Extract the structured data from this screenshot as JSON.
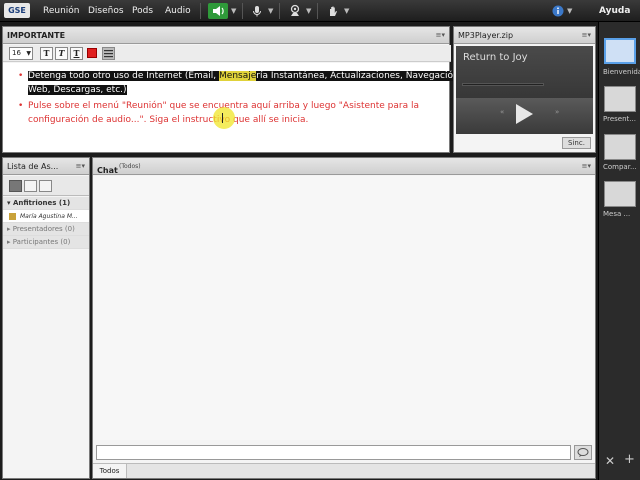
{
  "menubar": {
    "logo": "GSE",
    "items": [
      "Reunión",
      "Diseños",
      "Pods",
      "Audio"
    ],
    "help": "Ayuda",
    "colors": {
      "bar": "#2a2a2a",
      "speaker_active": "#2f9a3a"
    }
  },
  "note_pod": {
    "title": "IMPORTANTE",
    "font_size": "16",
    "color_swatch": "#e02020",
    "lines": [
      {
        "bullet": "•",
        "text_parts": [
          "Detenga todo otro uso de Internet (Email, ",
          "Mensaje",
          "ría Instantánea, Actualizaciones, Navegación"
        ],
        "line2": "Web, Descargas, etc.)"
      },
      {
        "bullet": "•",
        "text": "Pulse sobre el menú \"Reunión\" que se encuentra aquí arriba y luego \"Asistente para la",
        "line2": "configuración de audio...\". Siga el instructivo que allí se inicia."
      }
    ]
  },
  "mp3_pod": {
    "title": "MP3Player.zip",
    "track_title": "Return to Joy",
    "sync_label": "Sinc."
  },
  "attendee_pod": {
    "title": "Lista de As...",
    "groups": [
      {
        "label": "Anfitriones (1)",
        "expanded": true
      },
      {
        "label": "Presentadores (0)",
        "expanded": false
      },
      {
        "label": "Participantes (0)",
        "expanded": false
      }
    ],
    "hosts": [
      "María Agustina M..."
    ]
  },
  "chat_pod": {
    "title": "Chat",
    "scope": "(Todos)",
    "input_placeholder": "",
    "tab": "Todos"
  },
  "sidebar": {
    "layouts": [
      "Bienvenida",
      "Present...",
      "Compar...",
      "Mesa ..."
    ],
    "add": "+",
    "tools": "✕"
  }
}
